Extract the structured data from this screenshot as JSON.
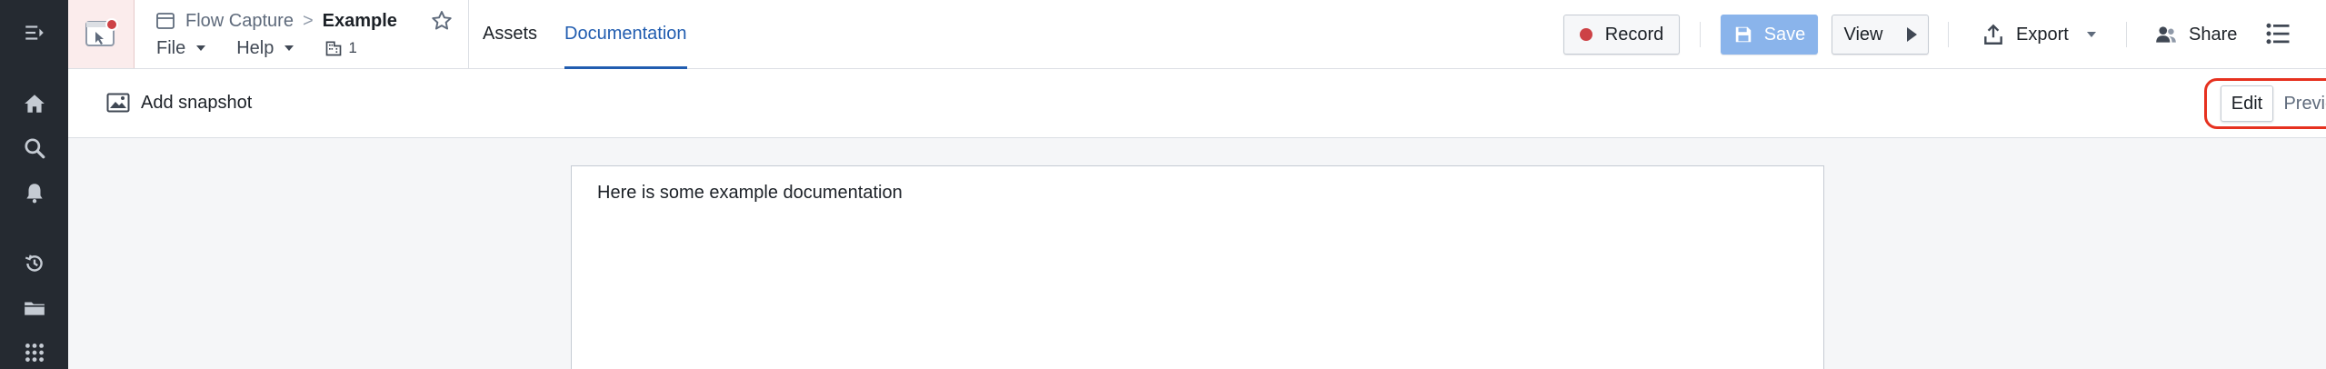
{
  "rail": {
    "icons": [
      "expand-sidebar-icon",
      "home-icon",
      "search-icon",
      "notifications-bell-icon",
      "history-icon",
      "folder-icon",
      "apps-grid-icon"
    ]
  },
  "header": {
    "breadcrumb": {
      "parent": "Flow Capture",
      "separator": ">",
      "current": "Example"
    },
    "menus": {
      "file": "File",
      "help": "Help"
    },
    "org_count": "1",
    "tabs": [
      {
        "label": "Assets",
        "active": false
      },
      {
        "label": "Documentation",
        "active": true
      }
    ],
    "buttons": {
      "record": "Record",
      "save": "Save",
      "view": "View",
      "export": "Export",
      "share": "Share"
    }
  },
  "toolbar": {
    "add_snapshot": "Add snapshot",
    "mode_edit": "Edit",
    "mode_preview": "Preview",
    "selected_mode": "Edit"
  },
  "document": {
    "text": "Here is some example documentation"
  },
  "colors": {
    "rail_bg": "#252a31",
    "accent_blue": "#215db0",
    "save_disabled": "#8ab4eb",
    "record_red": "#cd4246",
    "highlight_red": "#e6311f"
  }
}
